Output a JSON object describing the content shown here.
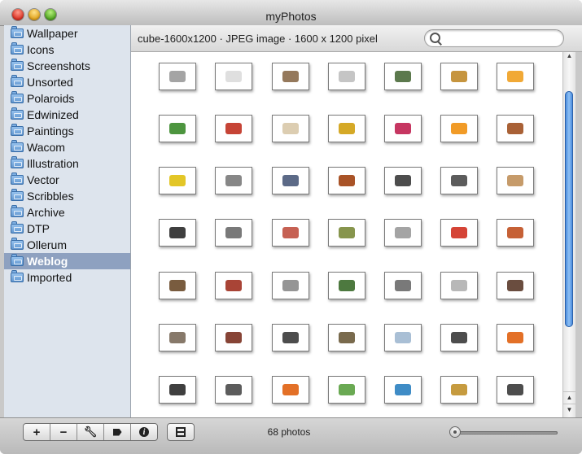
{
  "window": {
    "title": "myPhotos"
  },
  "sidebar": {
    "items": [
      {
        "label": "Wallpaper",
        "selected": false
      },
      {
        "label": "Icons",
        "selected": false
      },
      {
        "label": "Screenshots",
        "selected": false
      },
      {
        "label": "Unsorted",
        "selected": false
      },
      {
        "label": "Polaroids",
        "selected": false
      },
      {
        "label": "Edwinized",
        "selected": false
      },
      {
        "label": "Paintings",
        "selected": false
      },
      {
        "label": "Wacom",
        "selected": false
      },
      {
        "label": "Illustration",
        "selected": false
      },
      {
        "label": "Vector",
        "selected": false
      },
      {
        "label": "Scribbles",
        "selected": false
      },
      {
        "label": "Archive",
        "selected": false
      },
      {
        "label": "DTP",
        "selected": false
      },
      {
        "label": "Ollerum",
        "selected": false
      },
      {
        "label": "Weblog",
        "selected": true
      },
      {
        "label": "Imported",
        "selected": false
      }
    ]
  },
  "header": {
    "info": "cube-1600x1200 · JPEG image · 1600 x 1200 pixel"
  },
  "search": {
    "value": "",
    "placeholder": ""
  },
  "grid": {
    "thumb_colors": [
      "#9a9a9a",
      "#dcdcdc",
      "#8a6a4a",
      "#bfbfbf",
      "#4a6a3a",
      "#c08a2a",
      "#f0a020",
      "#3a8a2a",
      "#c03020",
      "#d8c8a8",
      "#d0a010",
      "#c02050",
      "#f09010",
      "#a05020",
      "#e0c010",
      "#7a7a7a",
      "#4a5a7a",
      "#a04010",
      "#3a3a3a",
      "#4a4a4a",
      "#c0905a",
      "#2a2a2a",
      "#6a6a6a",
      "#c05040",
      "#7a8a3a",
      "#9a9a9a",
      "#d03020",
      "#c05020",
      "#6a4a2a",
      "#a03020",
      "#8a8a8a",
      "#3a6a2a",
      "#6a6a6a",
      "#b0b0b0",
      "#5a3a2a",
      "#7a6a5a",
      "#7a3020",
      "#3a3a3a",
      "#6a5a3a",
      "#a0b8d0",
      "#3a3a3a",
      "#e06010",
      "#2a2a2a",
      "#4a4a4a",
      "#e06010",
      "#5aa040",
      "#2a80c0",
      "#c0902a",
      "#3a3a3a"
    ]
  },
  "toolbar": {
    "add_label": "+",
    "remove_label": "−",
    "icons": [
      "wrench-icon",
      "tag-icon",
      "info-icon",
      "filmstrip-icon"
    ]
  },
  "status": {
    "count": "68 photos"
  },
  "zoom": {
    "value": 0.0
  }
}
